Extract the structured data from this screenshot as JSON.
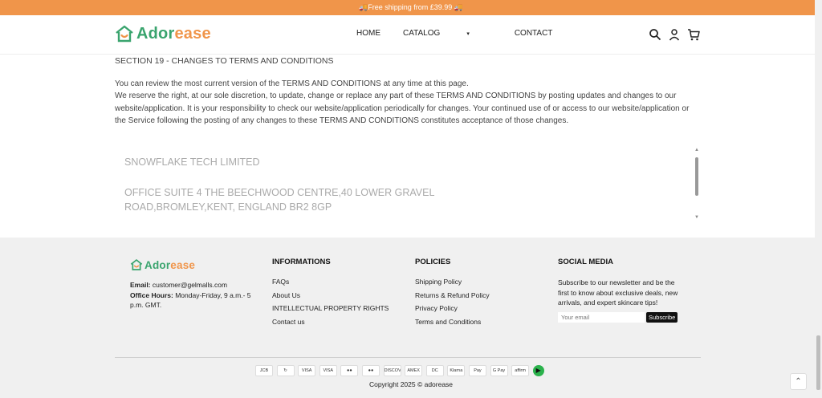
{
  "promo": {
    "text": "🚚Free shipping from £39.99 🚚"
  },
  "brand": {
    "part1": "Ador",
    "part2": "ease",
    "color_green": "#3aa46e",
    "color_orange": "#f0954a"
  },
  "nav": {
    "home": "HOME",
    "catalog": "CATALOG",
    "catalog_caret": "▾",
    "contact": "CONTACT"
  },
  "header_icons": [
    "search-icon",
    "user-icon",
    "cart-icon"
  ],
  "content": {
    "section_title": "SECTION 19 - CHANGES TO TERMS AND CONDITIONS",
    "para1": "You can review the most current version of the TERMS AND CONDITIONS at any time at this page.",
    "para2": "We reserve the right, at our sole discretion, to update, change or replace any part of these TERMS AND CONDITIONS by posting updates and changes to our website/application. It is your responsibility to check our website/application periodically for changes. Your continued use of or access to our website/application or the Service following the posting of any changes to these TERMS AND CONDITIONS constitutes acceptance of those changes."
  },
  "company": {
    "name": "SNOWFLAKE TECH LIMITED",
    "address": "OFFICE SUITE 4 THE BEECHWOOD CENTRE,40 LOWER GRAVEL ROAD,BROMLEY,KENT, ENGLAND BR2 8GP",
    "scroll_up": "▲",
    "scroll_down": "▼"
  },
  "footer": {
    "email_label": "Email:",
    "email_value": " customer@gelmalls.com",
    "hours_label": "Office Hours:",
    "hours_value": " Monday-Friday, 9 a.m.- 5 p.m. GMT.",
    "informations": {
      "title": "INFORMATIONS",
      "items": [
        "FAQs",
        "About Us",
        "INTELLECTUAL PROPERTY RIGHTS",
        "Contact us"
      ]
    },
    "policies": {
      "title": "POLICIES",
      "items": [
        "Shipping Policy",
        "Returns & Refund Policy",
        "Privacy Policy",
        "Terms and Conditions"
      ]
    },
    "social": {
      "title": "SOCIAL MEDIA",
      "text": "Subscribe to our newsletter and be the first to know about exclusive deals, new arrivals, and expert skincare tips!",
      "email_placeholder": "Your email",
      "subscribe_label": "Subscribe"
    },
    "payments": [
      "JCB",
      "↻",
      "VISA",
      "VISA",
      "●●",
      "●●",
      "DISCOVER",
      "AMEX",
      "DC",
      "Klarna",
      "Pay",
      "G Pay",
      "affirm",
      "▶"
    ],
    "copyright": "Copyright 2025 © adorease"
  },
  "back_to_top": "⌃"
}
